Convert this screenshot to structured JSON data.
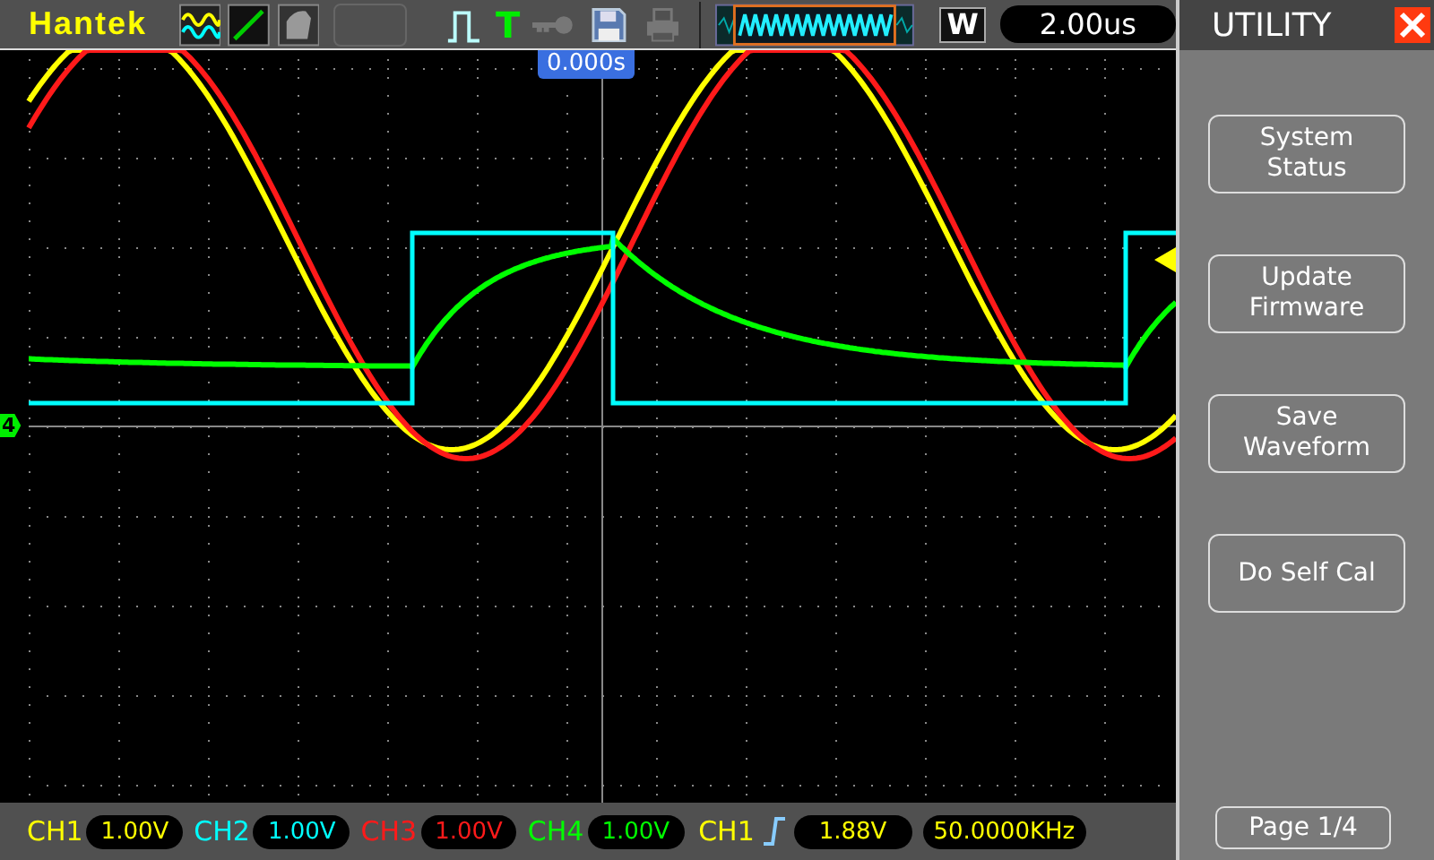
{
  "brand": "Hantek",
  "trigger_icon_text": "T",
  "timebase": {
    "mode": "W",
    "value": "2.00us"
  },
  "trigger_position": "0.000s",
  "ground_marker": "4",
  "channels": [
    {
      "name": "CH1",
      "scale": "1.00V",
      "color": "#ffff00"
    },
    {
      "name": "CH2",
      "scale": "1.00V",
      "color": "#00ffff"
    },
    {
      "name": "CH3",
      "scale": "1.00V",
      "color": "#ff1a1a"
    },
    {
      "name": "CH4",
      "scale": "1.00V",
      "color": "#00ff00"
    }
  ],
  "trigger": {
    "source": "CH1",
    "level": "1.88V",
    "frequency": "50.0000KHz"
  },
  "menu": {
    "title": "UTILITY",
    "buttons": [
      {
        "lines": [
          "System",
          "Status"
        ]
      },
      {
        "lines": [
          "Update",
          "Firmware"
        ]
      },
      {
        "lines": [
          "Save",
          "Waveform"
        ]
      },
      {
        "lines": [
          "Do Self Cal"
        ]
      }
    ],
    "page": "Page 1/4"
  }
}
